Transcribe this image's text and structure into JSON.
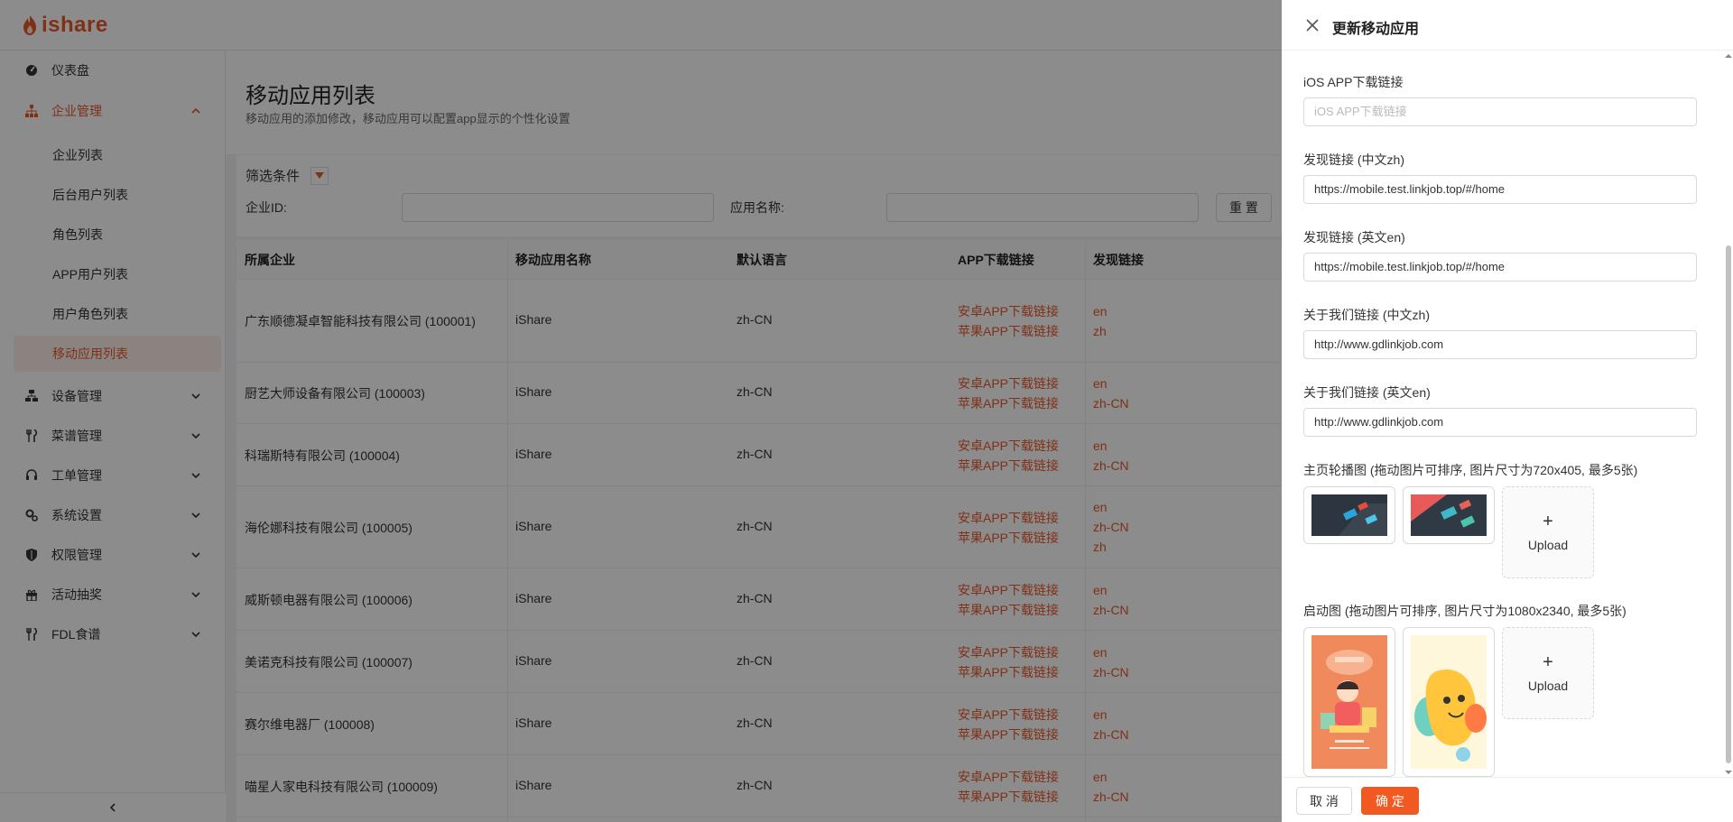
{
  "app": {
    "logo_text": "ishare",
    "brand_color": "#e8582b"
  },
  "sidebar": {
    "items": [
      {
        "label": "仪表盘",
        "icon": "dashboard-icon"
      },
      {
        "label": "企业管理",
        "icon": "org-icon",
        "expanded": true
      },
      {
        "label": "设备管理",
        "icon": "device-icon"
      },
      {
        "label": "菜谱管理",
        "icon": "fork-knife-icon"
      },
      {
        "label": "工单管理",
        "icon": "headset-icon"
      },
      {
        "label": "系统设置",
        "icon": "gears-icon"
      },
      {
        "label": "权限管理",
        "icon": "shield-icon"
      },
      {
        "label": "活动抽奖",
        "icon": "gift-icon"
      },
      {
        "label": "FDL食谱",
        "icon": "fork-knife-icon"
      }
    ],
    "sub_items": [
      "企业列表",
      "后台用户列表",
      "角色列表",
      "APP用户列表",
      "用户角色列表",
      "移动应用列表"
    ],
    "active_sub": "移动应用列表"
  },
  "page": {
    "title": "移动应用列表",
    "subtitle": "移动应用的添加修改，移动应用可以配置app显示的个性化设置"
  },
  "filter": {
    "title": "筛选条件",
    "company_id_label": "企业ID:",
    "app_name_label": "应用名称:",
    "reset_label": "重 置"
  },
  "table": {
    "headers": [
      "所属企业",
      "移动应用名称",
      "默认语言",
      "APP下载链接",
      "发现链接"
    ],
    "download_links": [
      "安卓APP下载链接",
      "苹果APP下载链接"
    ],
    "rows": [
      {
        "company": "广东顺德凝卓智能科技有限公司 (100001)",
        "app": "iShare",
        "lang": "zh-CN",
        "discover": [
          "en",
          "zh"
        ]
      },
      {
        "company": "厨艺大师设备有限公司 (100003)",
        "app": "iShare",
        "lang": "zh-CN",
        "discover": [
          "en",
          "zh-CN"
        ]
      },
      {
        "company": "科瑞斯特有限公司 (100004)",
        "app": "iShare",
        "lang": "zh-CN",
        "discover": [
          "en",
          "zh-CN"
        ]
      },
      {
        "company": "海伦娜科技有限公司 (100005)",
        "app": "iShare",
        "lang": "zh-CN",
        "discover": [
          "en",
          "zh-CN",
          "zh"
        ]
      },
      {
        "company": "威斯顿电器有限公司 (100006)",
        "app": "iShare",
        "lang": "zh-CN",
        "discover": [
          "en",
          "zh-CN"
        ]
      },
      {
        "company": "美诺克科技有限公司 (100007)",
        "app": "iShare",
        "lang": "zh-CN",
        "discover": [
          "en",
          "zh-CN"
        ]
      },
      {
        "company": "赛尔维电器厂 (100008)",
        "app": "iShare",
        "lang": "zh-CN",
        "discover": [
          "en",
          "zh-CN"
        ]
      },
      {
        "company": "喵星人家电科技有限公司 (100009)",
        "app": "iShare",
        "lang": "zh-CN",
        "discover": [
          "en",
          "zh-CN"
        ]
      }
    ]
  },
  "drawer": {
    "title": "更新移动应用",
    "fields": [
      {
        "label": "iOS APP下载链接",
        "value": "",
        "placeholder": "iOS APP下载链接"
      },
      {
        "label": "发现链接 (中文zh)",
        "value": "https://mobile.test.linkjob.top/#/home",
        "placeholder": ""
      },
      {
        "label": "发现链接 (英文en)",
        "value": "https://mobile.test.linkjob.top/#/home",
        "placeholder": ""
      },
      {
        "label": "关于我们链接 (中文zh)",
        "value": "http://www.gdlinkjob.com",
        "placeholder": ""
      },
      {
        "label": "关于我们链接 (英文en)",
        "value": "http://www.gdlinkjob.com",
        "placeholder": ""
      }
    ],
    "banner_label": "主页轮播图 (拖动图片可排序, 图片尺寸为720x405, 最多5张)",
    "splash_label": "启动图 (拖动图片可排序, 图片尺寸为1080x2340, 最多5张)",
    "upload_label": "Upload",
    "cancel_label": "取 消",
    "ok_label": "确 定"
  }
}
